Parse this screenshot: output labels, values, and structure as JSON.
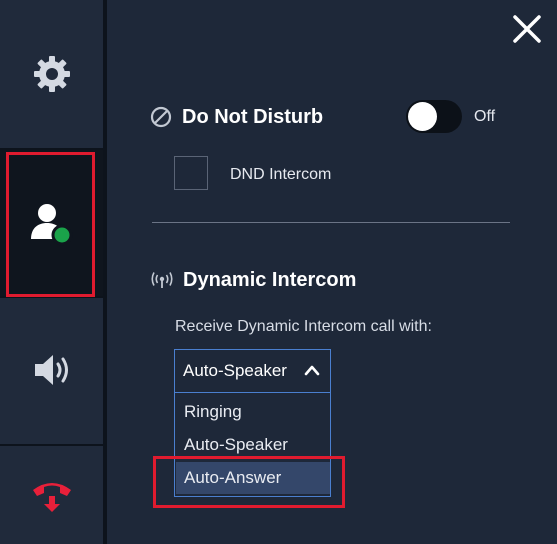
{
  "sidebar": {
    "items": [
      {
        "name": "settings",
        "icon": "gear-icon"
      },
      {
        "name": "presence",
        "icon": "user-presence-icon",
        "selected": true
      },
      {
        "name": "speaker",
        "icon": "speaker-icon"
      },
      {
        "name": "hangup",
        "icon": "phone-hangup-icon"
      }
    ]
  },
  "close_icon": "close-icon",
  "dnd": {
    "title": "Do Not Disturb",
    "toggle_state": "Off",
    "intercom_label": "DND Intercom"
  },
  "dynamic_intercom": {
    "title": "Dynamic Intercom",
    "description": "Receive Dynamic Intercom call with:",
    "selected": "Auto-Speaker",
    "options": [
      "Ringing",
      "Auto-Speaker",
      "Auto-Answer"
    ],
    "highlighted_option": "Auto-Answer"
  },
  "colors": {
    "background": "#1f2a3c",
    "sidebar_active": "#0f151e",
    "presence_green": "#1aa34a",
    "hangup_red": "#e8203a",
    "highlight_red": "#e01b2f",
    "select_border": "#4a7fd0",
    "option_highlight": "#34476a"
  }
}
